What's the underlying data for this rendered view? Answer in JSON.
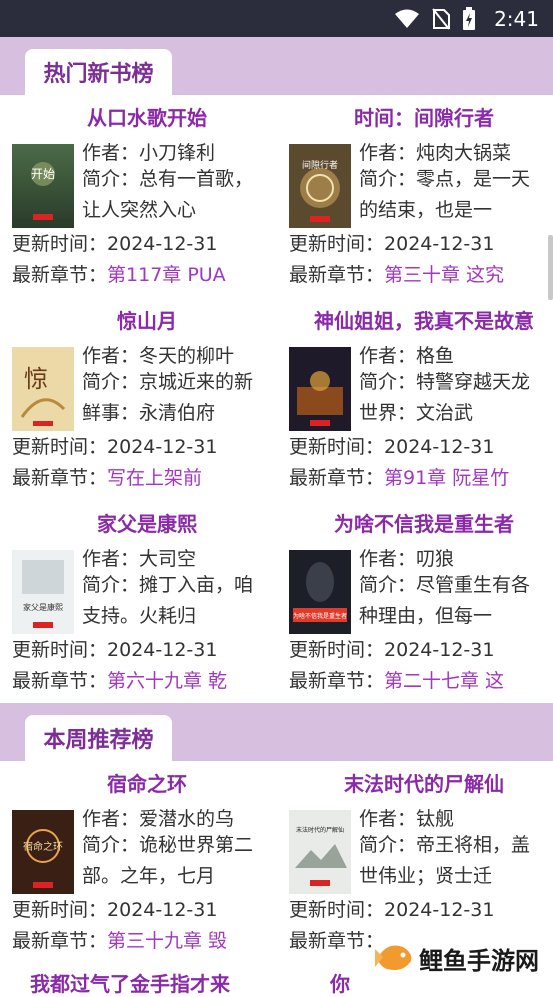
{
  "status_bar": {
    "time": "2:41"
  },
  "sections": [
    {
      "title": "热门新书榜",
      "books": [
        {
          "title": "从口水歌开始",
          "author_label": "作者：",
          "author": "小刀锋利",
          "intro_label": "简介：",
          "intro": "总有一首歌，让人突然入心",
          "updated_label": "更新时间：",
          "updated": "2024-12-31",
          "chapter_label": "最新章节：",
          "chapter": "第117章 PUA"
        },
        {
          "title": "时间：间隙行者",
          "author_label": "作者：",
          "author": "炖肉大锅菜",
          "intro_label": "简介：",
          "intro": "零点，是一天的结束，也是一",
          "updated_label": "更新时间：",
          "updated": "2024-12-31",
          "chapter_label": "最新章节：",
          "chapter": "第三十章 这究"
        },
        {
          "title": "惊山月",
          "author_label": "作者：",
          "author": "冬天的柳叶",
          "intro_label": "简介：",
          "intro": "京城近来的新鲜事：永清伯府",
          "updated_label": "更新时间：",
          "updated": "2024-12-31",
          "chapter_label": "最新章节：",
          "chapter": "写在上架前"
        },
        {
          "title": "神仙姐姐，我真不是故意",
          "author_label": "作者：",
          "author": "格鱼",
          "intro_label": "简介：",
          "intro": "特警穿越天龙世界：文治武",
          "updated_label": "更新时间：",
          "updated": "2024-12-31",
          "chapter_label": "最新章节：",
          "chapter": "第91章 阮星竹"
        },
        {
          "title": "家父是康熙",
          "author_label": "作者：",
          "author": "大司空",
          "intro_label": "简介：",
          "intro": "摊丁入亩，咱支持。火耗归",
          "updated_label": "更新时间：",
          "updated": "2024-12-31",
          "chapter_label": "最新章节：",
          "chapter": "第六十九章 乾"
        },
        {
          "title": "为啥不信我是重生者",
          "author_label": "作者：",
          "author": "叨狼",
          "intro_label": "简介：",
          "intro": "尽管重生有各种理由，但每一",
          "updated_label": "更新时间：",
          "updated": "2024-12-31",
          "chapter_label": "最新章节：",
          "chapter": "第二十七章 这"
        }
      ]
    },
    {
      "title": "本周推荐榜",
      "books": [
        {
          "title": "宿命之环",
          "author_label": "作者：",
          "author": "爱潜水的乌",
          "intro_label": "简介：",
          "intro": "诡秘世界第二部。之年，七月",
          "updated_label": "更新时间：",
          "updated": "2024-12-31",
          "chapter_label": "最新章节：",
          "chapter": "第三十九章 毁"
        },
        {
          "title": "末法时代的尸解仙",
          "author_label": "作者：",
          "author": "钛舰",
          "intro_label": "简介：",
          "intro": "帝王将相，盖世伟业；贤士迁",
          "updated_label": "更新时间：",
          "updated": "2024-12-31",
          "chapter_label": "最新章节：",
          "chapter": ""
        }
      ]
    }
  ],
  "cover_texts": {
    "b0": "开始",
    "b1": "间隙行者",
    "b2": "惊",
    "b4": "家父是康熙",
    "b5": "为啥不信我是重生者",
    "b6": "宿命之环",
    "b7": "末法时代的尸解仙"
  },
  "watermark": "鲤鱼手游网",
  "partial_titles": [
    "我都过气了金手指才来",
    "你"
  ],
  "colors": {
    "accent": "#8b2aa8",
    "band": "#d7c0df",
    "status": "#2b2d3c"
  }
}
